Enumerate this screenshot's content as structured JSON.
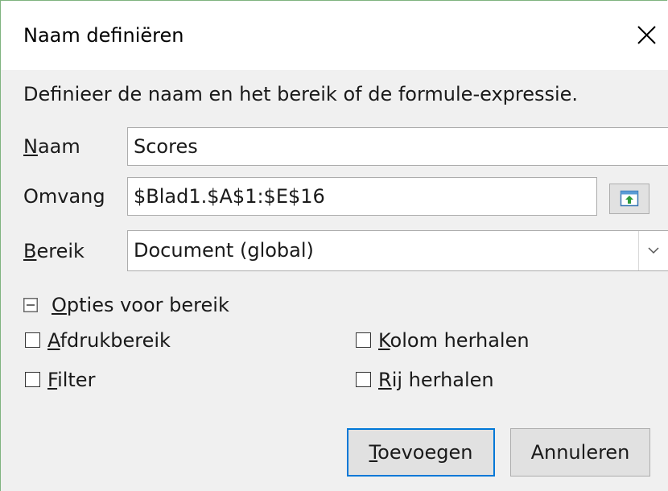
{
  "window": {
    "title": "Naam definiëren"
  },
  "description": "Definieer de naam en het bereik of de formule-expressie.",
  "name_field": {
    "label_accel": "N",
    "label_rest": "aam",
    "value": "Scores"
  },
  "scope_field": {
    "label": "Omvang",
    "value": "$Blad1.$A$1:$E$16"
  },
  "range_field": {
    "label_accel": "B",
    "label_rest": "ereik",
    "selected": "Document (global)"
  },
  "options": {
    "expander_accel": "O",
    "expander_rest": "pties voor bereik",
    "print_range": {
      "accel": "A",
      "rest": "fdrukbereik",
      "checked": false
    },
    "filter": {
      "accel": "F",
      "rest": "ilter",
      "checked": false
    },
    "repeat_column": {
      "accel": "K",
      "rest": "olom herhalen",
      "checked": false
    },
    "repeat_row": {
      "accel": "R",
      "rest": "ij herhalen",
      "checked": false
    }
  },
  "buttons": {
    "add_accel": "T",
    "add_rest": "oevoegen",
    "cancel": "Annuleren"
  },
  "colors": {
    "accent": "#0078d7",
    "window_border": "#7fb37f",
    "dialog_bg": "#f0f0f0"
  },
  "icons": {
    "close": "close-icon",
    "shrink": "shrink-dialog-icon",
    "dropdown": "chevron-down-icon",
    "expander": "collapse-minus-icon"
  }
}
